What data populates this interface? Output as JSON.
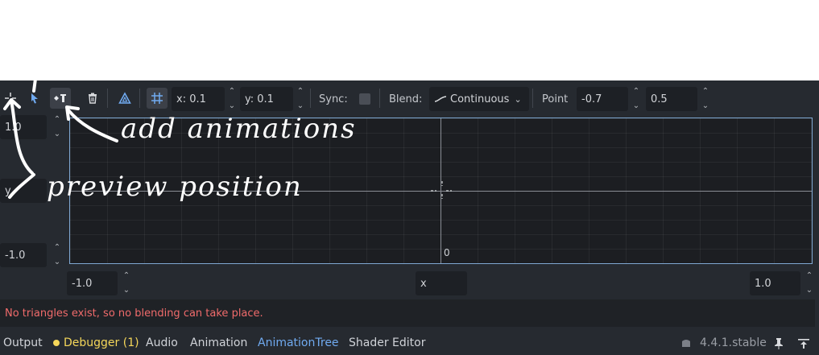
{
  "colors": {
    "panel_bg": "#262a30",
    "accent": "#70aaf0",
    "error": "#f06b6b",
    "debugger_dot": "#f5d75a",
    "annotation_ink": "#ffffff"
  },
  "toolbar": {
    "tools": [
      {
        "name": "preview-position-icon",
        "active": false
      },
      {
        "name": "select-cursor-icon",
        "active": false
      },
      {
        "name": "add-animation-point-icon",
        "active": true
      },
      {
        "name": "trash-icon",
        "active": false
      },
      {
        "name": "triangle-icon",
        "active": false
      },
      {
        "name": "snap-grid-icon",
        "active": false
      }
    ],
    "snap_x": "x: 0.1",
    "snap_y": "y: 0.1",
    "sync_label": "Sync:",
    "sync_checked": false,
    "blend_label": "Blend:",
    "blend_value": "Continuous",
    "point_label": "Point",
    "point_x": "-0.7",
    "point_y": "0.5"
  },
  "axes": {
    "y_max": "1.0",
    "y_label": "y",
    "y_min": "-1.0",
    "x_min": "-1.0",
    "x_label": "x",
    "x_max": "1.0",
    "origin_label": "0"
  },
  "status_message": "No triangles exist, so no blending can take place.",
  "bottom_tabs": {
    "output": "Output",
    "debugger": "Debugger (1)",
    "audio": "Audio",
    "animation": "Animation",
    "animation_tree": "AnimationTree",
    "shader_editor": "Shader Editor"
  },
  "version": "4.4.1.stable",
  "annotations": {
    "add_animations": "add animations",
    "preview_position": "preview position"
  }
}
